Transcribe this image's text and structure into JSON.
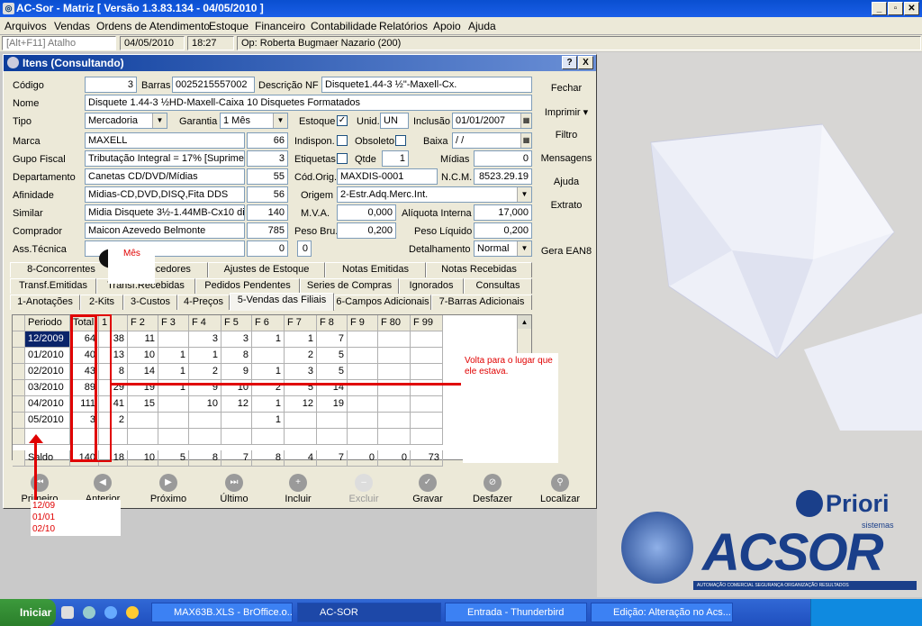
{
  "app": {
    "title": "AC-Sor - Matriz  [ Versão 1.3.83.134 - 04/05/2010 ]"
  },
  "menu": [
    "Arquivos",
    "Vendas",
    "Ordens de Atendimento",
    "Estoque",
    "Financeiro",
    "Contabilidade",
    "Relatórios",
    "Apoio",
    "Ajuda"
  ],
  "status": {
    "shortcut": "[Alt+F11] Atalho",
    "date": "04/05/2010",
    "time": "18:27",
    "operator": "Op: Roberta Bugmaer Nazario (200)"
  },
  "dialog": {
    "title": "Itens (Consultando)",
    "help": "?",
    "close": "X"
  },
  "form": {
    "codigo_l": "Código",
    "codigo": "3",
    "barras_l": "Barras",
    "barras": "0025215557002",
    "descnf_l": "Descrição NF",
    "descnf": "Disquete1.44-3 ½\"-Maxell-Cx.",
    "nome_l": "Nome",
    "nome": "Disquete 1.44-3 ½HD-Maxell-Caixa 10 Disquetes Formatados",
    "tipo_l": "Tipo",
    "tipo": "Mercadoria",
    "garantia_l": "Garantia",
    "garantia": "1 Mês",
    "estoque_l": "Estoque",
    "estoque": "✓",
    "unid_l": "Unid.",
    "unid": "UN",
    "inclusao_l": "Inclusão",
    "inclusao": "01/01/2007",
    "marca_l": "Marca",
    "marca": "MAXELL",
    "marca_n": "66",
    "indispon_l": "Indispon.",
    "obsoleto_l": "Obsoleto",
    "baixa_l": "Baixa",
    "baixa": " /  /",
    "grupo_l": "Gupo Fiscal",
    "grupo": "Tributação Integral = 17%  [Suprime",
    "grupo_n": "3",
    "etiquetas_l": "Etiquetas",
    "qtde_l": "Qtde",
    "qtde": "1",
    "midias_l": "Mídias",
    "midias": "0",
    "depto_l": "Departamento",
    "depto": "Canetas CD/DVD/Mídias",
    "depto_n": "55",
    "codorig_l": "Cód.Orig.",
    "codorig": "MAXDIS-0001",
    "ncm_l": "N.C.M.",
    "ncm": "8523.29.19",
    "afinidade_l": "Afinidade",
    "afinidade": "Midias-CD,DVD,DISQ,Fita DDS",
    "afinidade_n": "56",
    "origem_l": "Origem",
    "origem": "2-Estr.Adq.Merc.Int.",
    "similar_l": "Similar",
    "similar": "Midia Disquete 3½-1.44MB-Cx10 dis",
    "similar_n": "140",
    "mva_l": "M.V.A.",
    "mva": "0,000",
    "aliq_l": "Alíquota Interna",
    "aliq": "17,000",
    "comprador_l": "Comprador",
    "comprador": "Maicon Azevedo Belmonte",
    "comprador_n": "785",
    "pesobru_l": "Peso Bru.",
    "pesobru": "0,200",
    "pesoliq_l": "Peso Líquido",
    "pesoliq": "0,200",
    "asstec_l": "Ass.Técnica",
    "asstec_n": "0",
    "asstec_n2": "0",
    "detal_l": "Detalhamento",
    "detal": "Normal"
  },
  "side_buttons": [
    "Fechar",
    "Imprimir ▾",
    "Filtro",
    "Mensagens",
    "Ajuda",
    "Extrato",
    "Gera EAN8"
  ],
  "tabs_row1": [
    "8-Concorrentes",
    "Fornecedores",
    "Ajustes de Estoque",
    "Notas Emitidas",
    "Notas Recebidas"
  ],
  "tabs_row2": [
    "Transf.Emitidas",
    "Transf.Recebidas",
    "Pedidos Pendentes",
    "Series de Compras",
    "Ignorados",
    "Consultas"
  ],
  "tabs_row3": [
    "1-Anotações",
    "2-Kits",
    "3-Custos",
    "4-Preços",
    "5-Vendas das Filiais",
    "6-Campos Adicionais",
    "7-Barras Adicionais"
  ],
  "grid": {
    "headers": [
      "Periodo",
      "Total",
      "1",
      "F 2",
      "F 3",
      "F 4",
      "F 5",
      "F 6",
      "F 7",
      "F 8",
      "F 9",
      "F 80",
      "F 99"
    ],
    "rows": [
      [
        "12/2009",
        "64",
        "38",
        "11",
        "",
        "3",
        "3",
        "1",
        "1",
        "7",
        "",
        "",
        ""
      ],
      [
        "01/2010",
        "40",
        "13",
        "10",
        "1",
        "1",
        "8",
        "",
        "2",
        "5",
        "",
        "",
        ""
      ],
      [
        "02/2010",
        "43",
        "8",
        "14",
        "1",
        "2",
        "9",
        "1",
        "3",
        "5",
        "",
        "",
        ""
      ],
      [
        "03/2010",
        "89",
        "29",
        "19",
        "1",
        "9",
        "10",
        "2",
        "5",
        "14",
        "",
        "",
        ""
      ],
      [
        "04/2010",
        "111",
        "41",
        "15",
        "",
        "10",
        "12",
        "1",
        "12",
        "19",
        "",
        "",
        ""
      ],
      [
        "05/2010",
        "3",
        "2",
        "",
        "",
        "",
        "",
        "1",
        "",
        "",
        "",
        "",
        ""
      ],
      [
        "",
        "",
        "",
        "",
        "",
        "",
        "",
        "",
        "",
        "",
        "",
        "",
        ""
      ],
      [
        "Saldo",
        "140",
        "18",
        "10",
        "5",
        "8",
        "7",
        "8",
        "4",
        "7",
        "0",
        "0",
        "73"
      ]
    ]
  },
  "nav": [
    "Primeiro",
    "Anterior",
    "Próximo",
    "Último",
    "Incluir",
    "Excluir",
    "Gravar",
    "Desfazer",
    "Localizar"
  ],
  "annotations": {
    "mes": "Mês",
    "volta": "Volta  para o lugar que ele estava.",
    "dates": [
      "12/09",
      "01/01",
      "02/10"
    ]
  },
  "brand": {
    "priori": "Priori",
    "priori_sub": "sistemas",
    "acsor": "ACSOR",
    "tagline": "AUTOMAÇÃO   COMERCIAL   SEGURANÇA   ORGANIZAÇÃO   RESULTADOS"
  },
  "taskbar": {
    "start": "Iniciar",
    "items": [
      "MAX63B.XLS - BrOffice.o...",
      "AC-SOR",
      "Entrada - Thunderbird",
      "Edição: Alteração no Acs..."
    ]
  }
}
